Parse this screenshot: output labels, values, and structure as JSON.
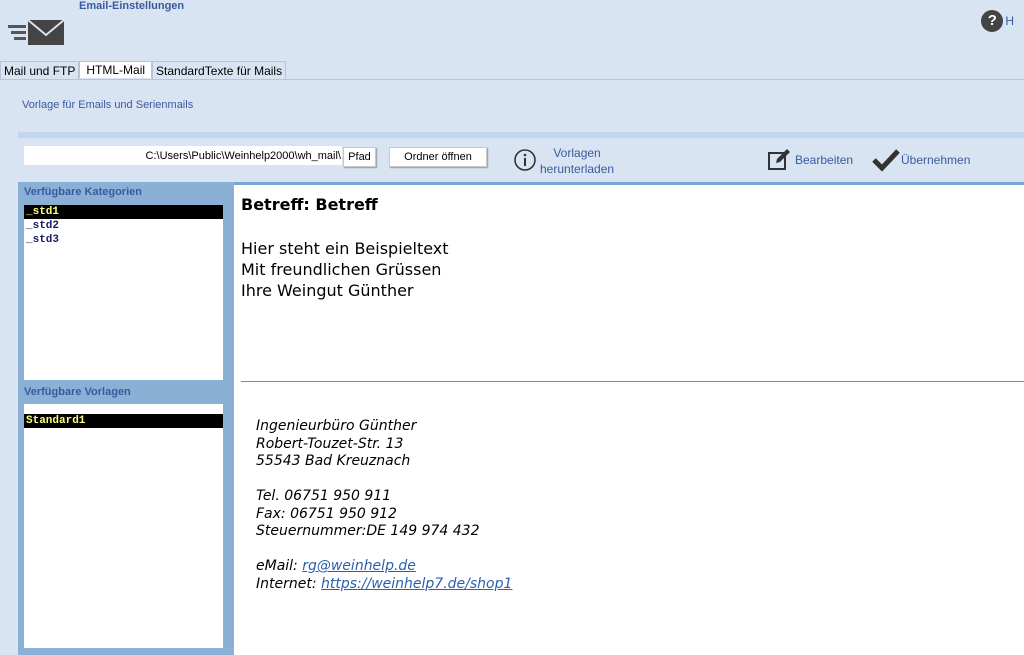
{
  "header": {
    "title": "Email-Einstellungen",
    "help_label": "H",
    "help_glyph": "?"
  },
  "tabs": [
    {
      "label": "Mail und FTP",
      "active": false
    },
    {
      "label": "HTML-Mail",
      "active": true
    },
    {
      "label": "StandardTexte für Mails",
      "active": false
    }
  ],
  "subtitle": "Vorlage für Emails und Serienmails",
  "toolbar": {
    "path_value": "C:\\Users\\Public\\Weinhelp2000\\wh_mail\\",
    "pfad_label": "Pfad",
    "ordner_label": "Ordner öffnen",
    "vorlagen_line1": "Vorlagen",
    "vorlagen_line2": "herunterladen",
    "bearbeiten_label": "Bearbeiten",
    "uebernehmen_label": "Übernehmen"
  },
  "kategorien": {
    "title": "Verfügbare Kategorien",
    "items": [
      "_std1",
      "_std2",
      "_std3"
    ],
    "selected_index": 0
  },
  "vorlagen": {
    "title": "Verfügbare Vorlagen",
    "items": [
      "Standard1"
    ],
    "selected_index": 0
  },
  "preview": {
    "subject": "Betreff: Betreff",
    "body": [
      "Hier steht ein Beispieltext",
      "Mit freundlichen Grüssen",
      "Ihre Weingut Günther"
    ],
    "signature": {
      "company": "Ingenieurbüro Günther",
      "street": "Robert-Touzet-Str. 13",
      "city": "55543 Bad Kreuznach",
      "tel": "Tel. 06751 950 911",
      "fax": "Fax: 06751 950 912",
      "tax": "Steuernummer:DE 149 974 432",
      "email_label": "eMail: ",
      "email": "rg@weinhelp.de",
      "internet_label": "Internet: ",
      "internet": "https://weinhelp7.de/shop1"
    }
  },
  "colors": {
    "accent_text": "#3a5aa0",
    "selection_bg": "#000000",
    "selection_fg": "#ffff80"
  }
}
